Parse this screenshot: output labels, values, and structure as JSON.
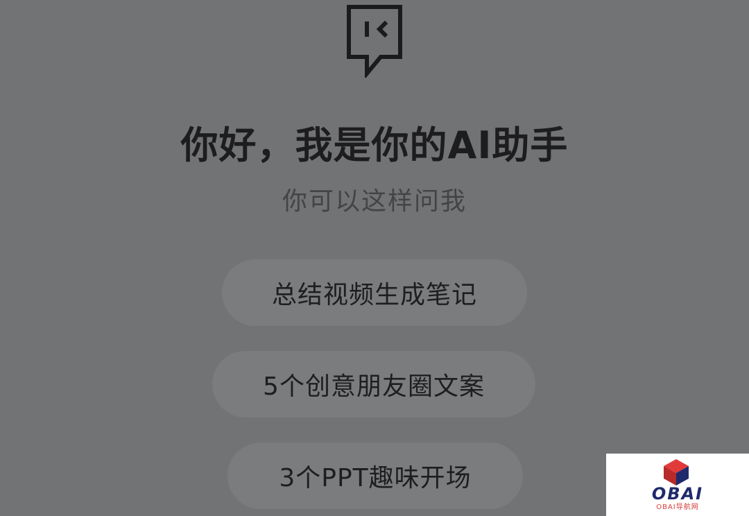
{
  "greeting": {
    "title": "你好，我是你的AI助手",
    "subtitle": "你可以这样问我"
  },
  "suggestions": [
    {
      "label": "总结视频生成笔记"
    },
    {
      "label": "5个创意朋友圈文案"
    },
    {
      "label": "3个PPT趣味开场"
    }
  ],
  "icons": {
    "assistant": "chat-bubble-face-icon",
    "watermark_logo": "cube-logo-icon"
  },
  "watermark": {
    "brand": "OBAI",
    "tagline": "OBAI导航网"
  },
  "colors": {
    "background": "#727374",
    "pill": "#7b7c7e",
    "title_text": "#1d1d1f",
    "subtitle_text": "#434447",
    "watermark_brand": "#1f2a6b",
    "watermark_accent": "#d63a3a"
  }
}
